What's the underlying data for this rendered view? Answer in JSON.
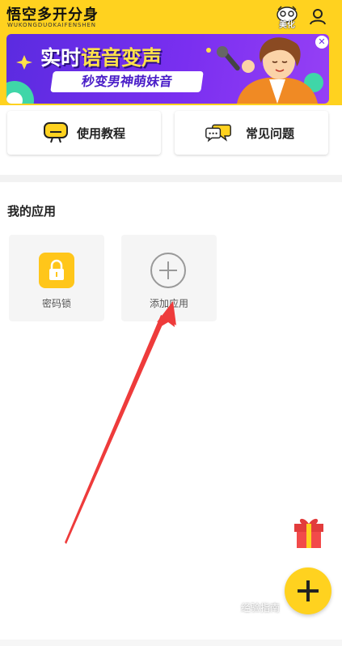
{
  "header": {
    "title": "悟空多开分身",
    "subtitle": "WUKONGDUOKAIFENSHEN",
    "beautify_label": "美化",
    "bg_color": "#FFD21F",
    "profile_icon": "user-icon",
    "beautify_icon": "mask-icon"
  },
  "banner": {
    "headline_part1": "实时",
    "headline_part2": "语音变声",
    "subline": "秒变男神萌妹音",
    "close_icon": "close-icon"
  },
  "quick_links": [
    {
      "label": "使用教程",
      "icon": "tutorial-icon"
    },
    {
      "label": "常见问题",
      "icon": "chat-bubbles-icon"
    }
  ],
  "my_apps": {
    "title": "我的应用",
    "tiles": [
      {
        "label": "密码锁",
        "icon": "lock-icon"
      },
      {
        "label": "添加应用",
        "icon": "plus-circle-icon"
      }
    ]
  },
  "floating": {
    "gift_icon": "gift-icon",
    "fab_icon": "plus-icon"
  },
  "watermark": "经验指南"
}
